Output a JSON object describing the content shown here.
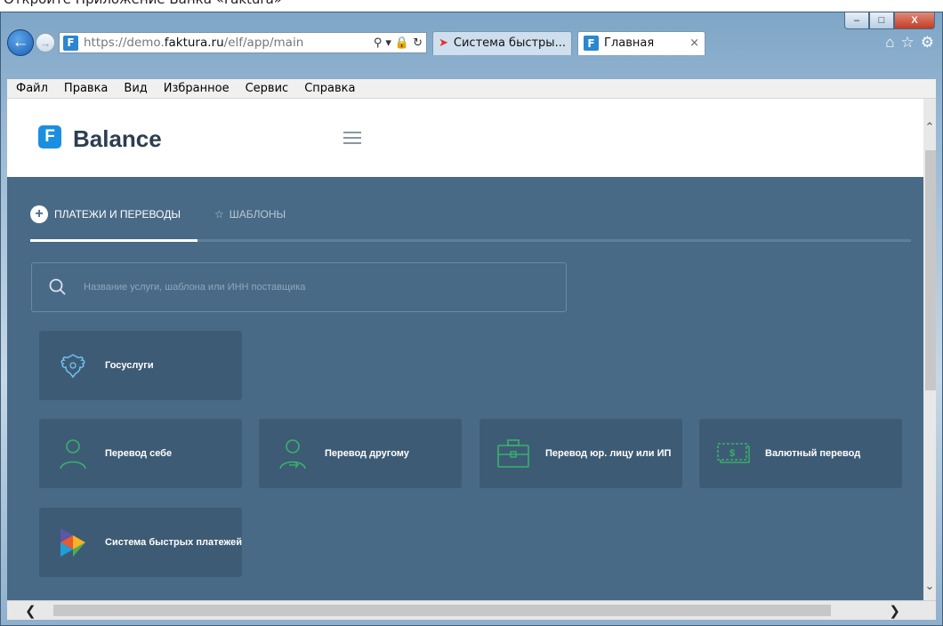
{
  "caption": "Откройте Приложение Банка «Faktura»",
  "browser": {
    "url_prefix": "https://demo.",
    "url_host": "faktura.ru",
    "url_path": "/elf/app/main",
    "tabs": [
      {
        "label": "Система быстры...",
        "active": false
      },
      {
        "label": "Главная",
        "active": true
      }
    ],
    "tab_close": "×",
    "window_controls": {
      "minimize": "–",
      "maximize": "□",
      "close": "X"
    }
  },
  "menu": [
    "Файл",
    "Правка",
    "Вид",
    "Избранное",
    "Сервис",
    "Справка"
  ],
  "app": {
    "logo_letter": "F",
    "brand": "Balance",
    "tabs": {
      "payments": "ПЛАТЕЖИ И ПЕРЕВОДЫ",
      "templates": "ШАБЛОНЫ"
    },
    "search_placeholder": "Название услуги, шаблона или ИНН поставщика",
    "tiles": {
      "gosuslugi": "Госуслуги",
      "self_transfer": "Перевод себе",
      "other_transfer": "Перевод другому",
      "legal_transfer": "Перевод юр. лицу или ИП",
      "currency_transfer": "Валютный перевод",
      "sbp": "Система быстрых платежей"
    }
  },
  "colors": {
    "app_background": "#496a87",
    "tile_background": "#3e5b75",
    "accent_green": "#36b36a",
    "brand_blue": "#1a8fe0"
  }
}
